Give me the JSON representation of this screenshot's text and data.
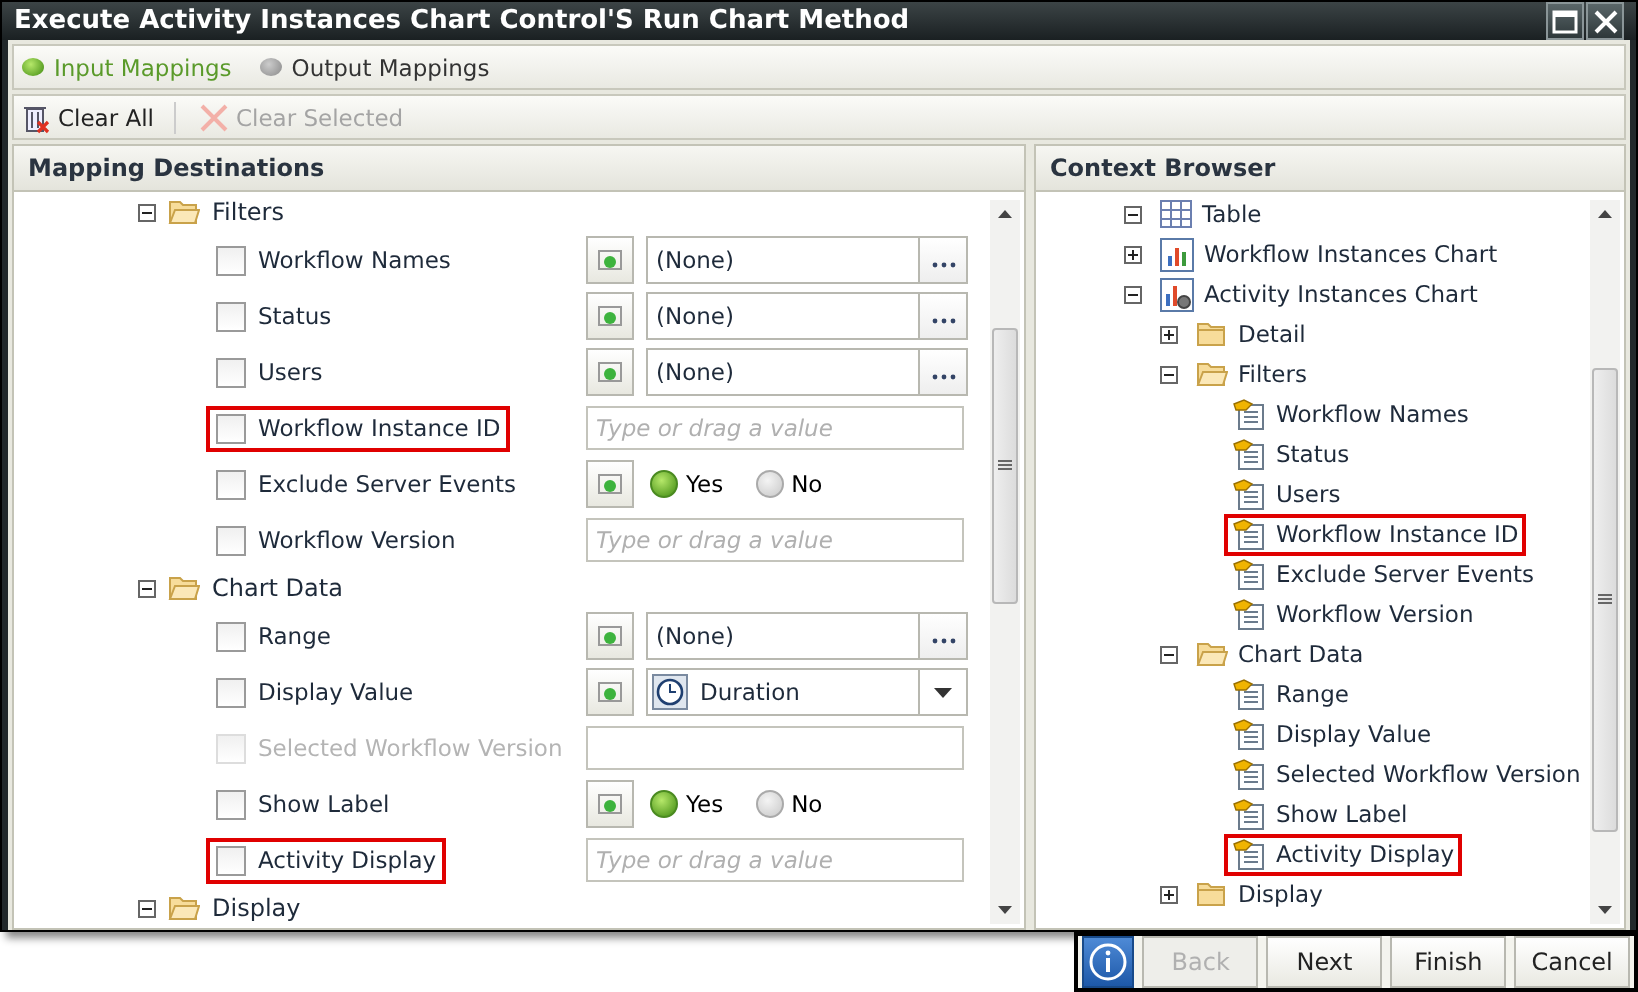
{
  "window": {
    "title": "Execute Activity Instances Chart Control'S Run Chart Method"
  },
  "tabs": [
    {
      "label": "Input Mappings",
      "selected": true
    },
    {
      "label": "Output Mappings",
      "selected": false
    }
  ],
  "toolbar": [
    {
      "label": "Clear All",
      "kind": "clear-all",
      "disabled": false
    },
    {
      "label": "Clear Selected",
      "kind": "clear-selected",
      "disabled": true
    }
  ],
  "mapping_destinations": {
    "title": "Mapping Destinations",
    "groups": [
      {
        "label": "Filters",
        "expanded": true,
        "items": [
          {
            "label": "Workflow Names",
            "checked": false,
            "disabled": false,
            "highlighted": false,
            "kind": "picker",
            "value": "(None)"
          },
          {
            "label": "Status",
            "checked": false,
            "disabled": false,
            "highlighted": false,
            "kind": "picker",
            "value": "(None)"
          },
          {
            "label": "Users",
            "checked": false,
            "disabled": false,
            "highlighted": false,
            "kind": "picker",
            "value": "(None)"
          },
          {
            "label": "Workflow Instance ID",
            "checked": false,
            "disabled": false,
            "highlighted": true,
            "kind": "text",
            "placeholder": "Type or drag a value"
          },
          {
            "label": "Exclude Server Events",
            "checked": false,
            "disabled": false,
            "highlighted": false,
            "kind": "radio",
            "options": [
              {
                "label": "Yes",
                "selected": true
              },
              {
                "label": "No",
                "selected": false
              }
            ]
          },
          {
            "label": "Workflow Version",
            "checked": false,
            "disabled": false,
            "highlighted": false,
            "kind": "text",
            "placeholder": "Type or drag a value"
          }
        ]
      },
      {
        "label": "Chart Data",
        "expanded": true,
        "items": [
          {
            "label": "Range",
            "checked": false,
            "disabled": false,
            "highlighted": false,
            "kind": "picker",
            "value": "(None)"
          },
          {
            "label": "Display Value",
            "checked": false,
            "disabled": false,
            "highlighted": false,
            "kind": "select",
            "value": "Duration"
          },
          {
            "label": "Selected Workflow Version",
            "checked": false,
            "disabled": true,
            "highlighted": false,
            "kind": "empty"
          },
          {
            "label": "Show Label",
            "checked": false,
            "disabled": false,
            "highlighted": false,
            "kind": "radio",
            "options": [
              {
                "label": "Yes",
                "selected": true
              },
              {
                "label": "No",
                "selected": false
              }
            ]
          },
          {
            "label": "Activity Display",
            "checked": false,
            "disabled": false,
            "highlighted": true,
            "kind": "text",
            "placeholder": "Type or drag a value"
          }
        ]
      },
      {
        "label": "Display",
        "expanded": true
      }
    ]
  },
  "context_browser": {
    "title": "Context Browser",
    "items": [
      {
        "label": "Table",
        "kind": "table",
        "expanded": true
      },
      {
        "label": "Workflow Instances Chart",
        "kind": "chart",
        "expanded": false
      },
      {
        "label": "Activity Instances Chart",
        "kind": "chart-settings",
        "expanded": true,
        "children": [
          {
            "label": "Detail",
            "kind": "folder",
            "expanded": false
          },
          {
            "label": "Filters",
            "kind": "folder",
            "expanded": true,
            "children": [
              {
                "label": "Workflow Names",
                "kind": "field",
                "highlighted": false
              },
              {
                "label": "Status",
                "kind": "field",
                "highlighted": false
              },
              {
                "label": "Users",
                "kind": "field",
                "highlighted": false
              },
              {
                "label": "Workflow Instance ID",
                "kind": "field",
                "highlighted": true
              },
              {
                "label": "Exclude Server Events",
                "kind": "field",
                "highlighted": false
              },
              {
                "label": "Workflow Version",
                "kind": "field",
                "highlighted": false
              }
            ]
          },
          {
            "label": "Chart Data",
            "kind": "folder",
            "expanded": true,
            "children": [
              {
                "label": "Range",
                "kind": "field",
                "highlighted": false
              },
              {
                "label": "Display Value",
                "kind": "field",
                "highlighted": false
              },
              {
                "label": "Selected Workflow Version",
                "kind": "field",
                "highlighted": false
              },
              {
                "label": "Show Label",
                "kind": "field",
                "highlighted": false
              },
              {
                "label": "Activity Display",
                "kind": "field",
                "highlighted": true
              }
            ]
          },
          {
            "label": "Display",
            "kind": "folder",
            "expanded": false
          }
        ]
      }
    ]
  },
  "footer": {
    "buttons": [
      {
        "label": "Back",
        "disabled": true
      },
      {
        "label": "Next",
        "disabled": false
      },
      {
        "label": "Finish",
        "disabled": false
      },
      {
        "label": "Cancel",
        "disabled": false
      }
    ]
  }
}
